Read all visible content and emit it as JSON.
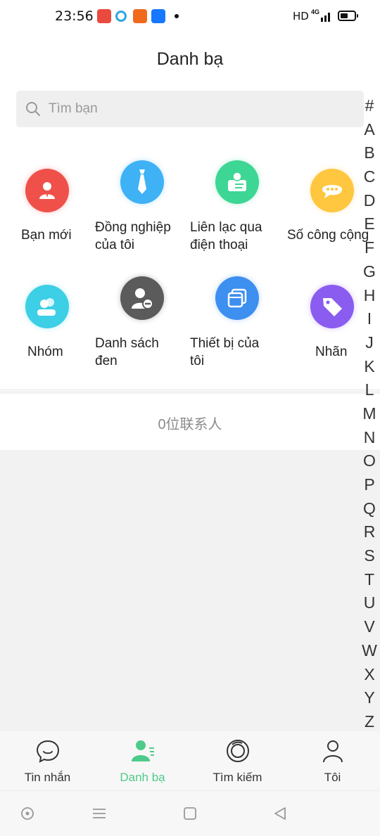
{
  "status_bar": {
    "time": "23:56",
    "hd": "HD",
    "network": "4G",
    "battery_level": 0.4,
    "notification_icons": [
      {
        "name": "app-notification-icon-1",
        "color": "#e94a3f"
      },
      {
        "name": "app-notification-icon-2",
        "color": "#2fa6e0"
      },
      {
        "name": "app-notification-icon-3",
        "color": "#f06a1d"
      },
      {
        "name": "zhihu-notification-icon",
        "color": "#1677ff"
      }
    ]
  },
  "header": {
    "title": "Danh bạ"
  },
  "search": {
    "placeholder": "Tìm bạn"
  },
  "grid": [
    {
      "label": "Bạn mới",
      "icon": "new-friend-icon",
      "color": "#f0504a"
    },
    {
      "label": "Đồng nghiệp\ncủa tôi",
      "icon": "colleague-tie-icon",
      "color": "#3fb1f5"
    },
    {
      "label": "Liên lạc qua\nđiện thoại",
      "icon": "phone-contact-icon",
      "color": "#3ed694"
    },
    {
      "label": "Số công cộng",
      "icon": "public-account-chat-icon",
      "color": "#ffc63f"
    },
    {
      "label": "Nhóm",
      "icon": "group-icon",
      "color": "#3ccfe6"
    },
    {
      "label": "Danh sách\nđen",
      "icon": "blacklist-icon",
      "color": "#5b5b5b"
    },
    {
      "label": "Thiết bị của\ntôi",
      "icon": "device-icon",
      "color": "#3d8ff0"
    },
    {
      "label": "Nhãn",
      "icon": "tag-icon",
      "color": "#8a5cf0"
    }
  ],
  "contact_count": "0位联系人",
  "alphabet": [
    "#",
    "A",
    "B",
    "C",
    "D",
    "E",
    "F",
    "G",
    "H",
    "I",
    "J",
    "K",
    "L",
    "M",
    "N",
    "O",
    "P",
    "Q",
    "R",
    "S",
    "T",
    "U",
    "V",
    "W",
    "X",
    "Y",
    "Z"
  ],
  "tabs": [
    {
      "label": "Tin nhắn",
      "icon": "chat-bubble-icon",
      "active": false
    },
    {
      "label": "Danh bạ",
      "icon": "contacts-icon",
      "active": true
    },
    {
      "label": "Tìm kiếm",
      "icon": "discover-icon",
      "active": false
    },
    {
      "label": "Tôi",
      "icon": "profile-icon",
      "active": false
    }
  ],
  "accent_color": "#4ecb8a"
}
